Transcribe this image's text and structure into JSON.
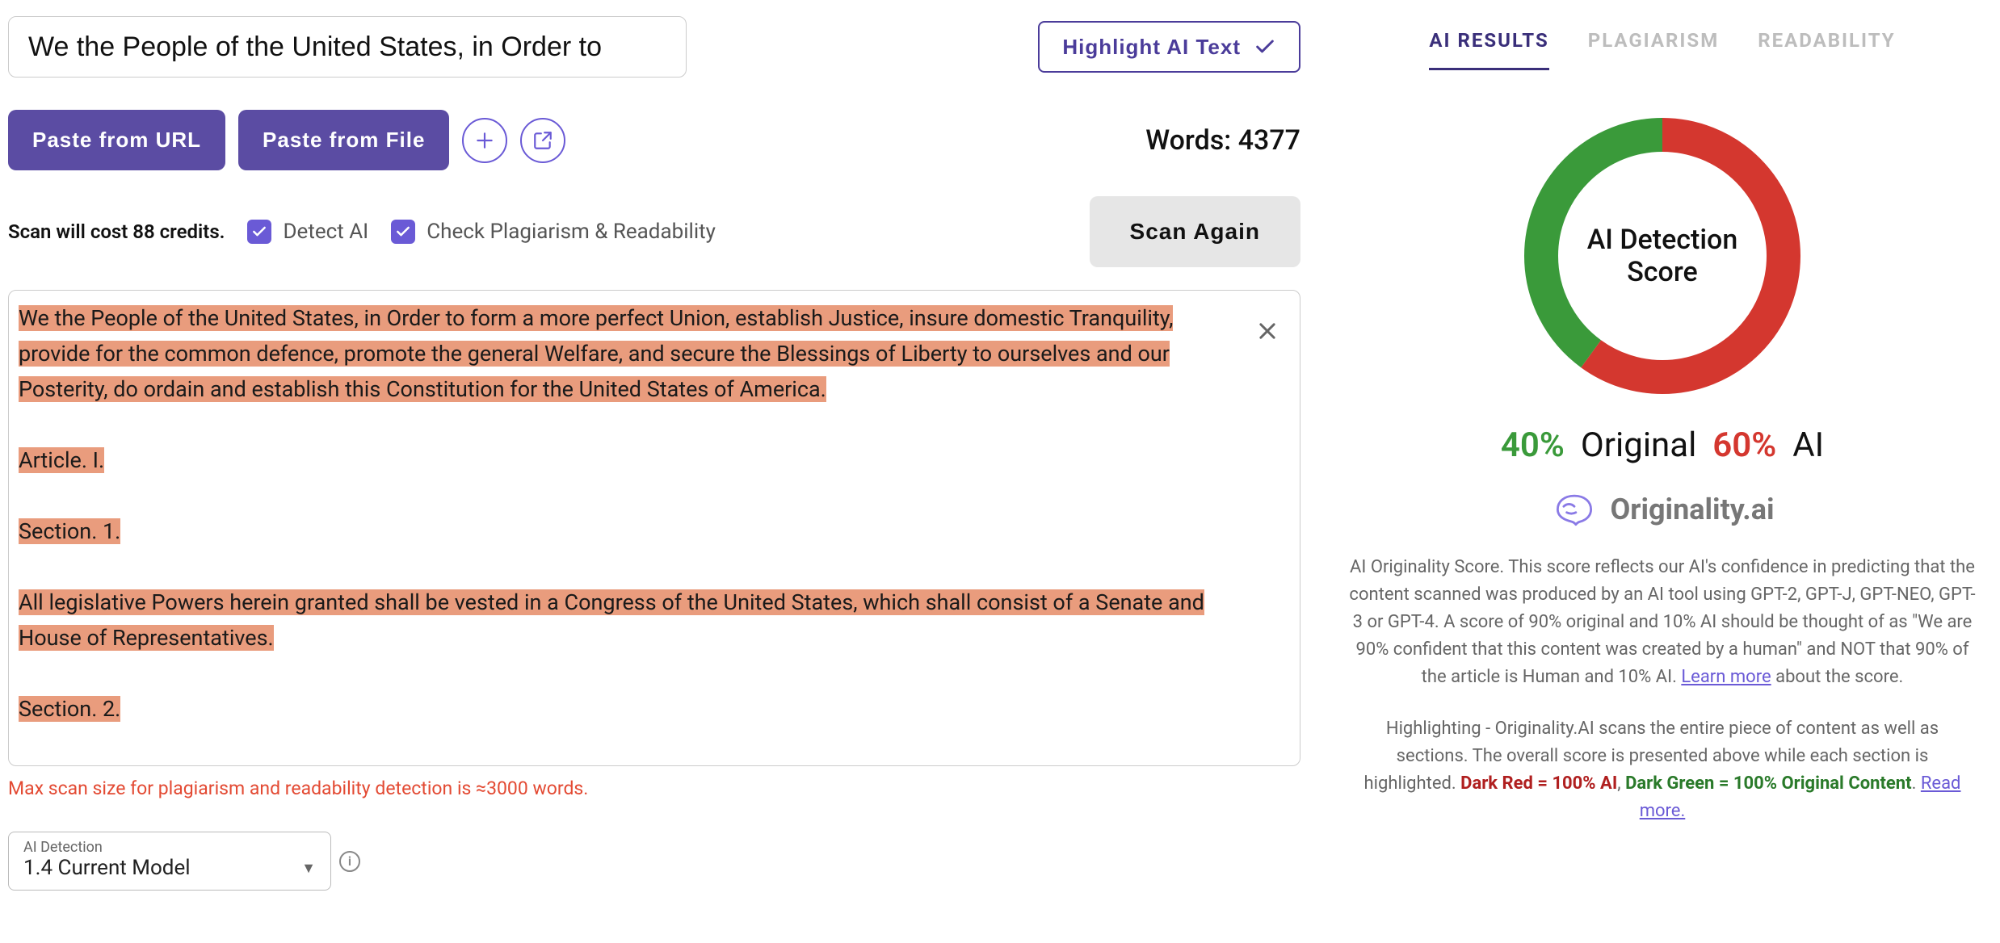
{
  "header": {
    "title_input_value": "We the People of the United States, in Order to",
    "highlight_btn": "Highlight AI Text"
  },
  "toolbar": {
    "paste_url": "Paste from URL",
    "paste_file": "Paste from File",
    "words_label": "Words:",
    "words_value": "4377"
  },
  "options": {
    "cost_text": "Scan will cost 88 credits.",
    "detect_ai_label": "Detect AI",
    "check_plag_label": "Check Plagiarism & Readability",
    "scan_btn": "Scan Again"
  },
  "content": {
    "lines": [
      "We the People of the United States, in Order to form a more perfect Union, establish Justice, insure domestic Tranquility, provide for the common defence, promote the general Welfare, and secure the Blessings of Liberty to ourselves and our Posterity, do ordain and establish this Constitution for the United States of America.",
      "Article. I.",
      "Section. 1.",
      "All legislative Powers herein granted shall be vested in a Congress of the United States, which shall consist of a Senate and House of Representatives.",
      "Section. 2."
    ],
    "warn": "Max scan size for plagiarism and readability detection is ≈3000 words."
  },
  "model": {
    "label": "AI Detection",
    "value": "1.4 Current Model"
  },
  "right": {
    "tabs": [
      "AI RESULTS",
      "PLAGIARISM",
      "READABILITY"
    ],
    "active_tab": 0,
    "donut_title_line1": "AI Detection",
    "donut_title_line2": "Score",
    "original_pct": "40%",
    "original_label": "Original",
    "ai_pct": "60%",
    "ai_label": "AI",
    "brand": "Originality.ai",
    "desc1_a": "AI Originality Score. This score reflects our AI's confidence in predicting that the content scanned was produced by an AI tool using GPT-2, GPT-J, GPT-NEO, GPT-3 or GPT-4. A score of 90% original and 10% AI should be thought of as \"We are 90% confident that this content was created by a human\" and NOT that 90% of the article is Human and 10% AI. ",
    "desc1_link": "Learn more",
    "desc1_b": " about the score.",
    "desc2_a": "Highlighting - Originality.AI scans the entire piece of content as well as sections. The overall score is presented above while each section is highlighted. ",
    "desc2_red": "Dark Red = 100% AI",
    "desc2_sep": ", ",
    "desc2_green": "Dark Green = 100% Original Content",
    "desc2_b": ". ",
    "desc2_link": "Read more."
  },
  "chart_data": {
    "type": "pie",
    "title": "AI Detection Score",
    "series": [
      {
        "name": "Original",
        "value": 40,
        "color": "#3a9a3a"
      },
      {
        "name": "AI",
        "value": 60,
        "color": "#d4372f"
      }
    ]
  }
}
